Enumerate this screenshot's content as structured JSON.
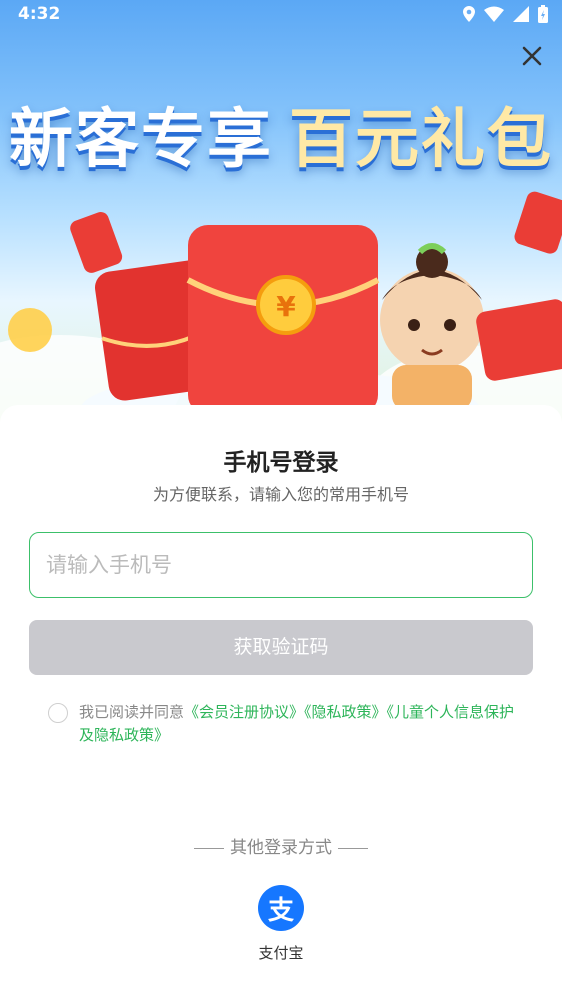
{
  "status_bar": {
    "time": "4:32"
  },
  "banner": {
    "headline_part1": "新客专享",
    "headline_part2": "百元礼包",
    "close_icon": "close-icon",
    "colors": {
      "sky": "#5ba8f5",
      "gold": "#ffe9a6",
      "red_packet": "#f03a3a"
    }
  },
  "login": {
    "title": "手机号登录",
    "subtitle": "为方便联系，请输入您的常用手机号",
    "phone_placeholder": "请输入手机号",
    "get_code_label": "获取验证码",
    "agreement_prefix": "我已阅读并同意",
    "agreement_links": [
      "《会员注册协议》",
      "《隐私政策》",
      "《儿童个人信息保护及隐私政策》"
    ],
    "accent_color": "#2eb55a"
  },
  "other_login": {
    "label": "其他登录方式",
    "alipay_glyph": "支",
    "alipay_label": "支付宝",
    "alipay_color": "#1677ff"
  }
}
